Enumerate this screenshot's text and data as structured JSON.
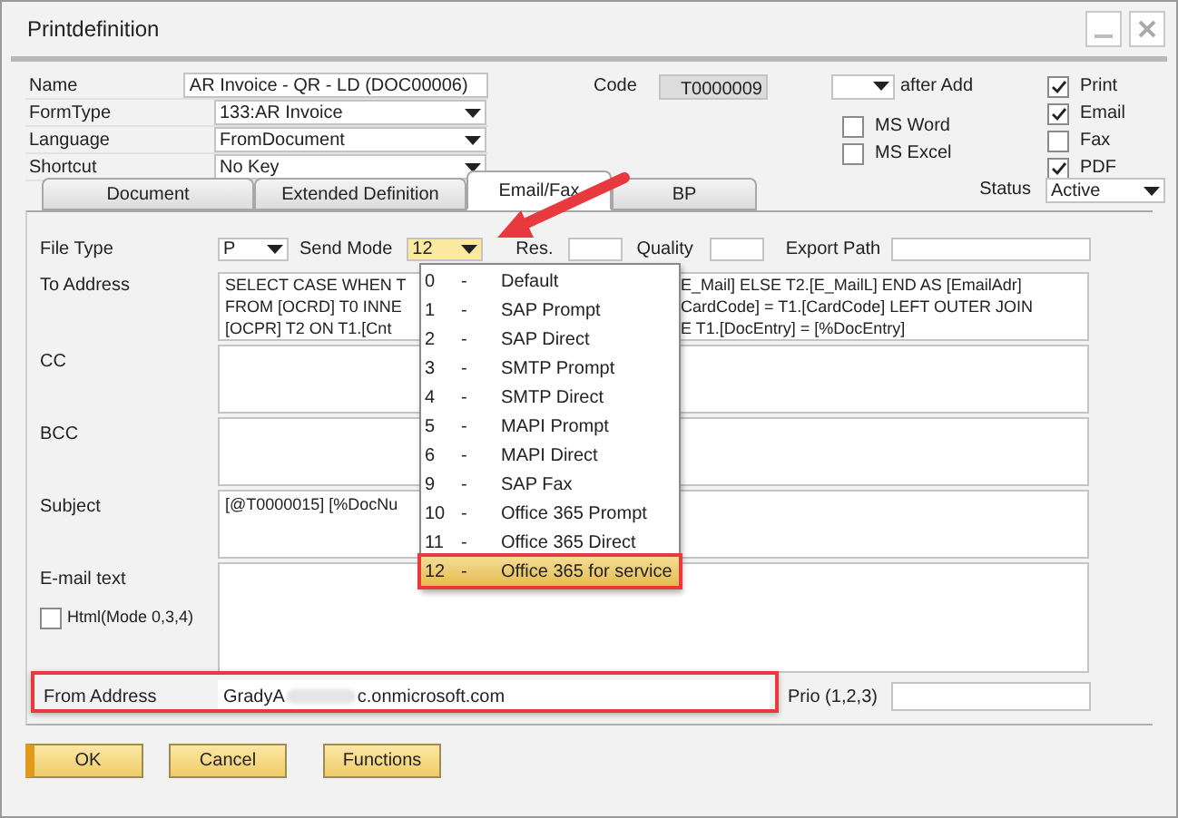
{
  "window": {
    "title": "Printdefinition"
  },
  "header": {
    "fields": [
      {
        "label": "Name",
        "value": "AR Invoice - QR - LD (DOC00006)",
        "kind": "text"
      },
      {
        "label": "FormType",
        "value": "133:AR Invoice",
        "kind": "dropdown"
      },
      {
        "label": "Language",
        "value": "FromDocument",
        "kind": "dropdown"
      },
      {
        "label": "Shortcut",
        "value": "No Key",
        "kind": "dropdown"
      }
    ],
    "code": {
      "label": "Code",
      "value": "T0000009"
    },
    "after_add": {
      "label": "after Add"
    },
    "office": [
      {
        "label": "MS Word",
        "checked": false
      },
      {
        "label": "MS Excel",
        "checked": false
      }
    ],
    "outputs": [
      {
        "label": "Print",
        "checked": true
      },
      {
        "label": "Email",
        "checked": true
      },
      {
        "label": "Fax",
        "checked": false
      },
      {
        "label": "PDF",
        "checked": true
      }
    ]
  },
  "tabs": [
    {
      "label": "Document",
      "selected": false
    },
    {
      "label": "Extended Definition",
      "selected": false
    },
    {
      "label": "Email/Fax",
      "selected": true
    },
    {
      "label": "BP",
      "selected": false
    }
  ],
  "status": {
    "label": "Status",
    "value": "Active"
  },
  "email_tab": {
    "file_type": {
      "label": "File Type",
      "value": "P"
    },
    "send_mode": {
      "label": "Send Mode",
      "value": "12"
    },
    "res": {
      "label": "Res."
    },
    "quality": {
      "label": "Quality"
    },
    "export_path": {
      "label": "Export Path"
    },
    "to_address": {
      "label": "To Address",
      "lines": [
        {
          "left": "SELECT CASE WHEN T",
          "right": "E_Mail] ELSE T2.[E_MailL] END AS [EmailAdr]"
        },
        {
          "left": "FROM [OCRD] T0 INNE",
          "right": "CardCode] = T1.[CardCode] LEFT OUTER JOIN"
        },
        {
          "left": "[OCPR] T2 ON T1.[Cnt",
          "right": "E T1.[DocEntry] = [%DocEntry]"
        }
      ]
    },
    "cc": {
      "label": "CC"
    },
    "bcc": {
      "label": "BCC"
    },
    "subject": {
      "label": "Subject",
      "value": "[@T0000015] [%DocNu"
    },
    "email_text": {
      "label": "E-mail text"
    },
    "html": {
      "label": "Html(Mode 0,3,4)",
      "checked": false
    },
    "from_address": {
      "label": "From Address",
      "value_start": "GradyA",
      "value_end": "c.onmicrosoft.com"
    },
    "prio": {
      "label": "Prio (1,2,3)"
    }
  },
  "send_mode_menu": [
    {
      "code": "0",
      "dash": "-",
      "label": "Default",
      "selected": false
    },
    {
      "code": "1",
      "dash": "-",
      "label": "SAP Prompt",
      "selected": false
    },
    {
      "code": "2",
      "dash": "-",
      "label": "SAP Direct",
      "selected": false
    },
    {
      "code": "3",
      "dash": "-",
      "label": "SMTP Prompt",
      "selected": false
    },
    {
      "code": "4",
      "dash": "-",
      "label": "SMTP Direct",
      "selected": false
    },
    {
      "code": "5",
      "dash": "-",
      "label": "MAPI Prompt",
      "selected": false
    },
    {
      "code": "6",
      "dash": "-",
      "label": "MAPI Direct",
      "selected": false
    },
    {
      "code": "9",
      "dash": "-",
      "label": "SAP Fax",
      "selected": false
    },
    {
      "code": "10",
      "dash": "-",
      "label": "Office 365 Prompt",
      "selected": false
    },
    {
      "code": "11",
      "dash": "-",
      "label": "Office 365 Direct",
      "selected": false
    },
    {
      "code": "12",
      "dash": "-",
      "label": "Office 365 for service",
      "selected": true
    }
  ],
  "buttons": [
    {
      "label": "OK",
      "kind": "primary"
    },
    {
      "label": "Cancel",
      "kind": "normal"
    },
    {
      "label": "Functions",
      "kind": "normal"
    }
  ]
}
